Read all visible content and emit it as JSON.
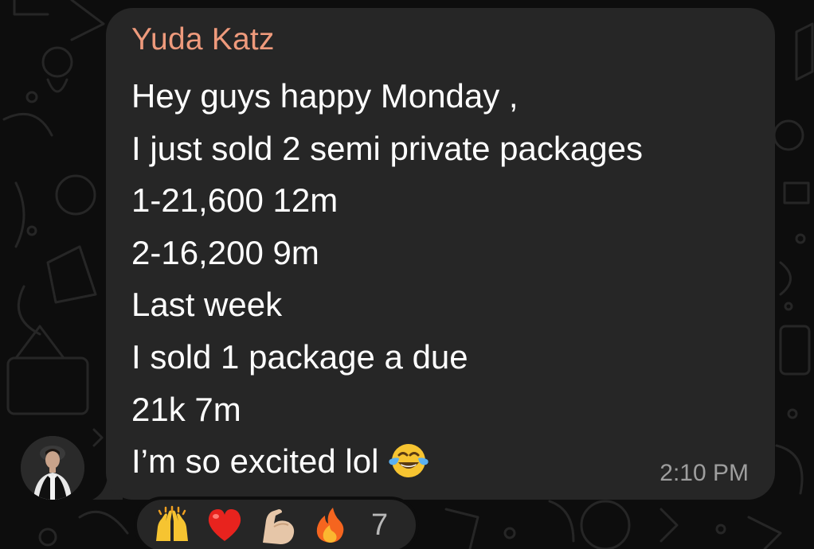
{
  "message": {
    "sender": "Yuda Katz",
    "lines": [
      "Hey guys happy Monday ,",
      "I just sold 2 semi private packages",
      "1-21,600 12m",
      "2-16,200 9m",
      "Last week",
      "I sold 1 package a due",
      "21k 7m",
      "I’m so excited lol"
    ],
    "trailing_emoji": "face-with-tears-of-joy",
    "time": "2:10 PM"
  },
  "reactions": {
    "emojis": [
      "raising-hands",
      "red-heart",
      "flexed-biceps",
      "fire"
    ],
    "count": "7"
  },
  "colors": {
    "background": "#0d0d0d",
    "bubble": "#262626",
    "sender_name": "#ee9a7c",
    "message_text": "#ffffff",
    "timestamp": "#9e9e9e"
  }
}
